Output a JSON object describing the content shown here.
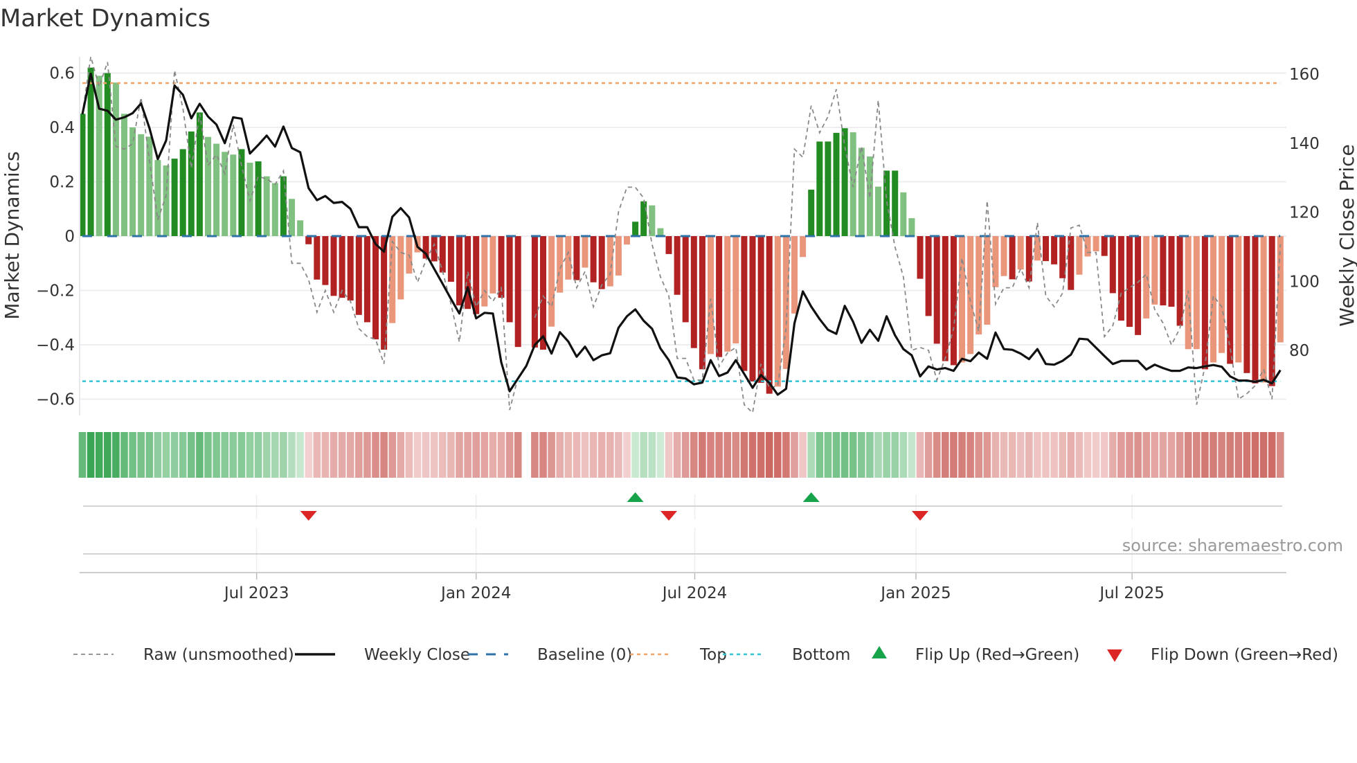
{
  "title": "Market Dynamics",
  "source": "source: sharemaestro.com",
  "colors": {
    "bar_green_strong": "#228b22",
    "bar_green_weak": "#80c080",
    "bar_red_strong": "#b22222",
    "bar_red_weak": "#e9967a",
    "band_green_light": "#d6eedb",
    "band_green_dark": "#3aa655",
    "band_red_light": "#f4d6d5",
    "band_red_dark": "#c9605a",
    "close": "#111111",
    "raw": "#888888",
    "baseline": "#2f72a8",
    "top": "#f0a468",
    "bottom": "#2ec4d6",
    "flip_up": "#16a34a",
    "flip_down": "#dc2626"
  },
  "chart_data": {
    "type": "bar",
    "title": "Market Dynamics",
    "ylabel": "Market Dynamics",
    "y2label": "Weekly Close Price",
    "ylim": [
      -0.66,
      0.66
    ],
    "y2lim": [
      61.2,
      165
    ],
    "y_ticks": [
      {
        "value": 0.6,
        "label": "0.6"
      },
      {
        "value": 0.4,
        "label": "0.4"
      },
      {
        "value": 0.2,
        "label": "0.2"
      },
      {
        "value": 0,
        "label": "0"
      },
      {
        "value": -0.2,
        "label": "−0.2"
      },
      {
        "value": -0.4,
        "label": "−0.4"
      },
      {
        "value": -0.6,
        "label": "−0.6"
      }
    ],
    "y2_ticks": [
      {
        "value": 160,
        "label": "160"
      },
      {
        "value": 140,
        "label": "140"
      },
      {
        "value": 120,
        "label": "120"
      },
      {
        "value": 100,
        "label": "100"
      },
      {
        "value": 80,
        "label": "80"
      }
    ],
    "x_unit": "week index",
    "x_ticks": [
      {
        "week": 20.8,
        "label": "Jul 2023"
      },
      {
        "week": 47.0,
        "label": "Jan 2024"
      },
      {
        "week": 73.1,
        "label": "Jul 2024"
      },
      {
        "week": 99.5,
        "label": "Jan 2025"
      },
      {
        "week": 125.3,
        "label": "Jul 2025"
      }
    ],
    "grid": true,
    "baseline": 0,
    "top": 0.563,
    "bottom": -0.534,
    "dynamics": [
      0.45,
      0.62,
      0.59,
      0.6,
      0.565,
      0.45,
      0.4,
      0.375,
      0.366,
      0.28,
      0.26,
      0.285,
      0.32,
      0.385,
      0.455,
      0.365,
      0.34,
      0.31,
      0.3,
      0.32,
      0.27,
      0.275,
      0.22,
      0.195,
      0.22,
      0.137,
      0.058,
      -0.03,
      -0.16,
      -0.18,
      -0.22,
      -0.227,
      -0.237,
      -0.29,
      -0.317,
      -0.38,
      -0.418,
      -0.32,
      -0.233,
      -0.138,
      -0.06,
      -0.083,
      -0.093,
      -0.134,
      -0.168,
      -0.255,
      -0.268,
      -0.287,
      -0.259,
      -0.211,
      -0.227,
      -0.317,
      -0.408,
      null,
      -0.41,
      -0.418,
      -0.333,
      -0.208,
      -0.16,
      -0.162,
      -0.116,
      -0.17,
      -0.195,
      -0.185,
      -0.145,
      -0.031,
      0.053,
      0.128,
      0.113,
      0.029,
      -0.066,
      -0.216,
      -0.317,
      -0.412,
      -0.49,
      -0.434,
      -0.445,
      -0.425,
      -0.395,
      -0.496,
      -0.535,
      -0.54,
      -0.58,
      -0.554,
      -0.489,
      -0.285,
      -0.077,
      0.171,
      0.348,
      0.348,
      0.38,
      0.397,
      0.382,
      0.325,
      0.293,
      0.182,
      0.241,
      0.241,
      0.161,
      0.066,
      -0.157,
      -0.294,
      -0.396,
      -0.46,
      -0.475,
      -0.465,
      -0.434,
      -0.362,
      -0.326,
      -0.188,
      -0.147,
      -0.159,
      -0.123,
      -0.167,
      -0.09,
      -0.092,
      -0.104,
      -0.155,
      -0.198,
      -0.142,
      -0.075,
      -0.056,
      -0.073,
      -0.21,
      -0.311,
      -0.334,
      -0.364,
      -0.303,
      -0.252,
      -0.255,
      -0.26,
      -0.33,
      -0.416,
      -0.416,
      -0.49,
      -0.465,
      -0.43,
      -0.47,
      -0.465,
      -0.504,
      -0.542,
      -0.539,
      -0.552,
      -0.391
    ],
    "strong": [
      1,
      1,
      0,
      1,
      0,
      0,
      0,
      0,
      0,
      0,
      0,
      1,
      1,
      1,
      1,
      0,
      0,
      0,
      0,
      1,
      0,
      1,
      0,
      0,
      1,
      0,
      0,
      1,
      1,
      1,
      1,
      1,
      1,
      1,
      1,
      1,
      1,
      0,
      0,
      0,
      0,
      1,
      1,
      1,
      1,
      1,
      1,
      1,
      0,
      0,
      1,
      1,
      1,
      0,
      1,
      1,
      0,
      0,
      0,
      1,
      0,
      1,
      1,
      0,
      0,
      0,
      1,
      1,
      0,
      0,
      1,
      1,
      1,
      1,
      1,
      0,
      1,
      0,
      0,
      1,
      1,
      1,
      1,
      0,
      0,
      0,
      0,
      1,
      1,
      1,
      1,
      1,
      0,
      0,
      0,
      0,
      1,
      1,
      0,
      0,
      1,
      1,
      1,
      1,
      1,
      0,
      0,
      0,
      0,
      0,
      0,
      1,
      0,
      1,
      0,
      1,
      1,
      1,
      1,
      0,
      0,
      0,
      1,
      1,
      1,
      1,
      1,
      0,
      0,
      1,
      1,
      1,
      0,
      0,
      1,
      0,
      0,
      1,
      0,
      1,
      1,
      0,
      1,
      0
    ],
    "raw": [
      0.45,
      0.66,
      0.55,
      0.64,
      0.33,
      0.32,
      0.34,
      0.51,
      0.28,
      0.06,
      0.15,
      0.61,
      0.47,
      0.25,
      0.45,
      0.26,
      0.3,
      0.23,
      0.41,
      0.26,
      0.13,
      0.22,
      0.21,
      0.19,
      0.24,
      -0.1,
      -0.1,
      -0.16,
      -0.28,
      -0.2,
      -0.28,
      -0.2,
      -0.24,
      -0.34,
      -0.37,
      -0.38,
      -0.47,
      -0.02,
      -0.06,
      -0.07,
      -0.17,
      -0.09,
      -0.03,
      -0.13,
      -0.25,
      -0.39,
      -0.13,
      -0.26,
      -0.2,
      -0.24,
      -0.19,
      -0.64,
      -0.52,
      null,
      -0.3,
      -0.22,
      -0.26,
      -0.12,
      -0.06,
      -0.19,
      -0.13,
      -0.26,
      -0.18,
      -0.14,
      0.09,
      0.18,
      0.18,
      0.14,
      -0.03,
      -0.15,
      -0.22,
      -0.45,
      -0.45,
      -0.53,
      -0.53,
      -0.23,
      -0.48,
      -0.43,
      -0.41,
      -0.62,
      -0.65,
      -0.47,
      -0.56,
      -0.55,
      -0.34,
      0.32,
      0.29,
      0.48,
      0.38,
      0.44,
      0.54,
      0.33,
      0.18,
      0.33,
      0.14,
      0.5,
      0.13,
      -0.04,
      -0.15,
      -0.42,
      -0.41,
      -0.42,
      -0.53,
      -0.45,
      -0.34,
      -0.08,
      -0.24,
      -0.35,
      0.13,
      -0.25,
      -0.19,
      -0.19,
      -0.12,
      -0.19,
      0.05,
      -0.22,
      -0.26,
      -0.21,
      0.03,
      0.04,
      -0.06,
      -0.06,
      -0.37,
      -0.33,
      -0.21,
      -0.19,
      -0.17,
      -0.14,
      -0.27,
      -0.32,
      -0.4,
      -0.34,
      -0.2,
      -0.62,
      -0.48,
      -0.22,
      -0.26,
      -0.41,
      -0.6,
      -0.58,
      -0.55,
      -0.49,
      -0.6,
      -0.03
    ],
    "close": [
      148.4,
      160.1,
      150,
      149.4,
      146.8,
      147.5,
      148.7,
      151.5,
      144.4,
      135.4,
      140.8,
      156.7,
      154,
      147.2,
      151.4,
      147.7,
      145.4,
      140,
      147.5,
      147.1,
      137,
      139.5,
      142.2,
      139,
      144.8,
      138.6,
      137.4,
      127,
      123.5,
      124.7,
      122.7,
      123,
      121,
      115.7,
      115.7,
      110.8,
      108.6,
      118.7,
      121.2,
      118.5,
      110,
      108,
      103.6,
      99.3,
      94.9,
      90.7,
      98.3,
      89.3,
      90.9,
      90.7,
      76.6,
      68.2,
      71.9,
      75.6,
      81.6,
      84.1,
      79.1,
      85.3,
      82.6,
      78.2,
      81.1,
      77.2,
      78.6,
      79.2,
      86.6,
      89.9,
      91.9,
      88.6,
      86.3,
      80.6,
      77.2,
      72.2,
      71.9,
      70.2,
      70.7,
      77.2,
      72.6,
      73.6,
      77.2,
      73.2,
      69.2,
      72.9,
      70.6,
      67.2,
      68.9,
      87.9,
      97.1,
      92.7,
      89.1,
      86.0,
      84.8,
      92.9,
      88.3,
      82.2,
      86.0,
      82.8,
      89.9,
      84.4,
      80.4,
      78.6,
      72.5,
      75.4,
      74.5,
      74.9,
      74.1,
      77.6,
      76.9,
      79.4,
      77.6,
      85.2,
      80.4,
      80.2,
      79.1,
      77.5,
      80.4,
      76.1,
      75.9,
      77.0,
      78.8,
      83.4,
      83.2,
      80.8,
      78.4,
      76.1,
      77.0,
      77.0,
      77.0,
      74.5,
      75.9,
      74.9,
      74.1,
      74.1,
      75.1,
      74.9,
      75.4,
      75.8,
      75.3,
      72.5,
      71.3,
      71.3,
      70.9,
      71.5,
      70.5,
      74.3
    ],
    "flip_up_weeks": [
      66,
      87
    ],
    "flip_down_weeks": [
      27,
      70,
      100
    ],
    "legend": [
      {
        "key": "raw",
        "label": "Raw (unsmoothed)"
      },
      {
        "key": "close",
        "label": "Weekly Close"
      },
      {
        "key": "baseline",
        "label": "Baseline (0)"
      },
      {
        "key": "top",
        "label": "Top"
      },
      {
        "key": "bottom",
        "label": "Bottom"
      },
      {
        "key": "flip_up",
        "label": "Flip Up (Red→Green)"
      },
      {
        "key": "flip_down",
        "label": "Flip Down (Green→Red)"
      }
    ]
  }
}
